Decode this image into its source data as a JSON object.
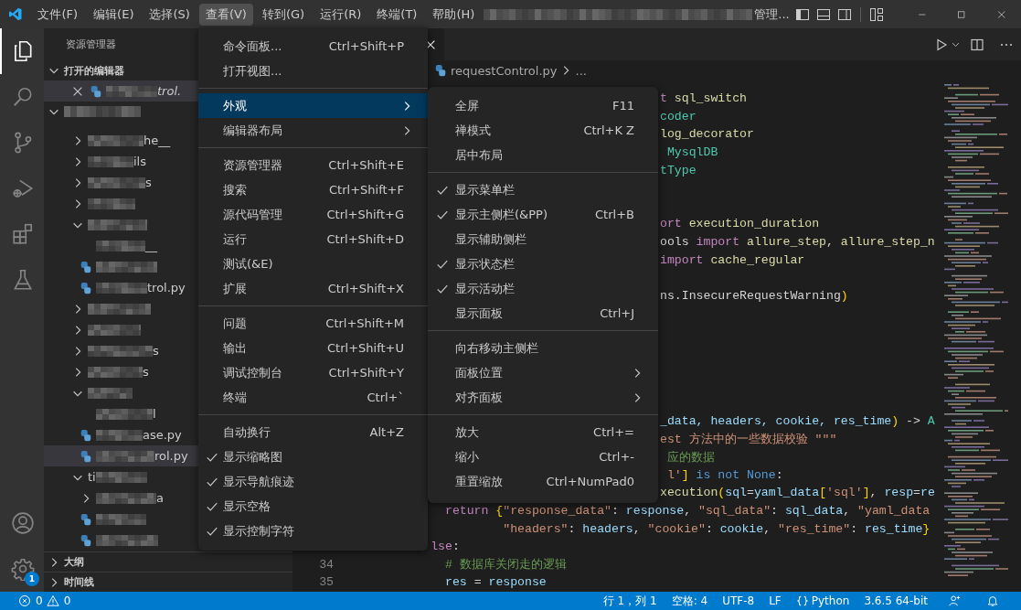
{
  "title_bar": {
    "menus": [
      {
        "label": "文件(F)",
        "selected": false
      },
      {
        "label": "编辑(E)",
        "selected": false
      },
      {
        "label": "选择(S)",
        "selected": false
      },
      {
        "label": "查看(V)",
        "selected": true
      },
      {
        "label": "转到(G)",
        "selected": false
      },
      {
        "label": "运行(R)",
        "selected": false
      },
      {
        "label": "终端(T)",
        "selected": false
      },
      {
        "label": "帮助(H)",
        "selected": false
      }
    ],
    "title_redacted": true,
    "account_text": "管理..."
  },
  "activity_bar": {
    "items": [
      {
        "kind": "files",
        "selected": true
      },
      {
        "kind": "search",
        "selected": false
      },
      {
        "kind": "source_control",
        "selected": false
      },
      {
        "kind": "run_debug",
        "selected": false
      },
      {
        "kind": "extensions",
        "selected": false
      },
      {
        "kind": "testing",
        "selected": false
      }
    ],
    "settings_badge": "1"
  },
  "sidebar": {
    "title": "资源管理器",
    "open_editors": {
      "label": "打开的编辑器",
      "expanded": true,
      "items": [
        {
          "name": "trol.",
          "preview": true,
          "selected": true
        }
      ]
    },
    "folder": {
      "expanded": true,
      "tree": [
        {
          "kind": "folder",
          "label": "he__",
          "blur_before": true,
          "expanded": false,
          "selected": false
        },
        {
          "kind": "folder",
          "label": "ils",
          "blur_before": true,
          "expanded": false,
          "selected": false
        },
        {
          "kind": "folder",
          "label": "s",
          "blur_before": true,
          "expanded": false,
          "selected": false
        },
        {
          "kind": "folder",
          "blur_before": true,
          "expanded": false,
          "selected": false
        },
        {
          "kind": "folder",
          "blur_before": true,
          "expanded": true,
          "selected": false,
          "children": [
            {
              "kind": "file",
              "label": "__",
              "blur_before": true,
              "selected": false
            },
            {
              "kind": "python",
              "blur_before": true,
              "selected": false
            },
            {
              "kind": "python",
              "label": "trol.py",
              "blur_before": true,
              "selected": false
            }
          ]
        },
        {
          "kind": "folder",
          "blur_before": true,
          "expanded": false,
          "selected": false
        },
        {
          "kind": "folder",
          "blur_before": true,
          "expanded": false,
          "selected": false
        },
        {
          "kind": "folder",
          "label": "s",
          "blur_before": true,
          "expanded": false,
          "selected": false
        },
        {
          "kind": "folder",
          "label": "s",
          "blur_before": true,
          "expanded": false,
          "selected": false
        },
        {
          "kind": "folder",
          "blur_before": true,
          "expanded": true,
          "selected": false,
          "children": [
            {
              "kind": "file",
              "label": "l",
              "blur_before": true,
              "selected": false
            },
            {
              "kind": "python",
              "label": "ase.py",
              "blur_before": true,
              "selected": false
            },
            {
              "kind": "python",
              "label": "rol.py",
              "blur_before": true,
              "selected": true
            }
          ]
        },
        {
          "kind": "folder",
          "label": "ti",
          "blur_after": true,
          "expanded": true,
          "selected": false,
          "children": [
            {
              "kind": "folder",
              "label": "a",
              "blur_before": true,
              "expanded": false,
              "selected": false
            },
            {
              "kind": "python",
              "blur_before": true,
              "selected": false
            },
            {
              "kind": "python",
              "blur_before": true,
              "selected": false
            }
          ]
        }
      ]
    },
    "sections": [
      {
        "label": "大纲",
        "expanded": false
      },
      {
        "label": "时间线",
        "expanded": false
      }
    ]
  },
  "editor": {
    "breadcrumb": {
      "file": "requestControl.py",
      "more": "..."
    },
    "lines": [
      {
        "kind": "clipped",
        "tokens": [
          {
            "kind": "control",
            "text": "t"
          },
          {
            "kind": "function",
            "text": " sql_switch"
          }
        ]
      },
      {
        "kind": "clipped",
        "tokens": [
          {
            "kind": "class",
            "text": "coder"
          }
        ]
      },
      {
        "kind": "clipped",
        "tokens": [
          {
            "kind": "function",
            "text": "log_decorator"
          }
        ]
      },
      {
        "kind": "clipped",
        "tokens": [
          {
            "kind": "class",
            "text": " MysqlDB"
          }
        ]
      },
      {
        "kind": "clipped",
        "tokens": [
          {
            "kind": "class",
            "text": "tType"
          }
        ]
      },
      {
        "kind": "blank"
      },
      {
        "kind": "blank"
      },
      {
        "kind": "clipped",
        "tokens": [
          {
            "kind": "control",
            "text": "ort"
          },
          {
            "kind": "function",
            "text": " execution_duration"
          }
        ]
      },
      {
        "kind": "clipped",
        "tokens": [
          {
            "kind": "plain",
            "text": "ools "
          },
          {
            "kind": "control",
            "text": "import"
          },
          {
            "kind": "function",
            "text": " allure_step"
          },
          {
            "kind": "plain",
            "text": ", "
          },
          {
            "kind": "function",
            "text": "allure_step_n"
          }
        ]
      },
      {
        "kind": "clipped",
        "tokens": [
          {
            "kind": "control",
            "text": "import"
          },
          {
            "kind": "function",
            "text": " cache_regular"
          }
        ]
      },
      {
        "kind": "blank"
      },
      {
        "kind": "clipped",
        "tokens": [
          {
            "kind": "plain",
            "text": "ns.InsecureRequestWarning"
          },
          {
            "kind": "bracket",
            "text": ")"
          }
        ]
      },
      {
        "kind": "blank"
      },
      {
        "kind": "blank"
      },
      {
        "kind": "blank"
      },
      {
        "kind": "blank"
      },
      {
        "kind": "blank"
      },
      {
        "kind": "blank"
      },
      {
        "kind": "clipped",
        "tokens": [
          {
            "kind": "variable",
            "text": "_data, headers, cookie, res_time"
          },
          {
            "kind": "bracket",
            "text": ")"
          },
          {
            "kind": "plain",
            "text": " -> "
          },
          {
            "kind": "class",
            "text": "A"
          }
        ]
      },
      {
        "kind": "clipped",
        "tokens": [
          {
            "kind": "string",
            "text": "est 方法中的一些数据校验 \"\"\""
          }
        ]
      },
      {
        "kind": "clipped",
        "tokens": [
          {
            "kind": "comment",
            "text": " 应的数据"
          }
        ]
      },
      {
        "kind": "clipped",
        "tokens": [
          {
            "kind": "string",
            "text": " l'"
          },
          {
            "kind": "bracket",
            "text": "]"
          },
          {
            "kind": "constant",
            "text": " is not None"
          },
          {
            "kind": "plain",
            "text": ":"
          }
        ]
      },
      {
        "kind": "clipped",
        "tokens": [
          {
            "kind": "function",
            "text": "xecution"
          },
          {
            "kind": "bracket",
            "text": "("
          },
          {
            "kind": "variable",
            "text": "sql"
          },
          {
            "kind": "plain",
            "text": "="
          },
          {
            "kind": "variable",
            "text": "yaml_data"
          },
          {
            "kind": "bracket",
            "text": "["
          },
          {
            "kind": "string",
            "text": "'sql'"
          },
          {
            "kind": "bracket",
            "text": "]"
          },
          {
            "kind": "plain",
            "text": ", "
          },
          {
            "kind": "variable",
            "text": "resp"
          },
          {
            "kind": "plain",
            "text": "="
          },
          {
            "kind": "variable",
            "text": "re"
          }
        ]
      },
      {
        "kind": "full",
        "tokens": [
          {
            "kind": "control",
            "text": "            return"
          },
          {
            "kind": "bracket",
            "text": " {"
          },
          {
            "kind": "string",
            "text": "\"response_data\""
          },
          {
            "kind": "plain",
            "text": ": "
          },
          {
            "kind": "variable",
            "text": "response"
          },
          {
            "kind": "plain",
            "text": ", "
          },
          {
            "kind": "string",
            "text": "\"sql_data\""
          },
          {
            "kind": "plain",
            "text": ": "
          },
          {
            "kind": "variable",
            "text": "sql_data"
          },
          {
            "kind": "plain",
            "text": ", "
          },
          {
            "kind": "string",
            "text": "\"yaml_data"
          }
        ]
      },
      {
        "kind": "full",
        "tokens": [
          {
            "kind": "string",
            "text": "                    \"headers\""
          },
          {
            "kind": "plain",
            "text": ": "
          },
          {
            "kind": "variable",
            "text": "headers"
          },
          {
            "kind": "plain",
            "text": ", "
          },
          {
            "kind": "string",
            "text": "\"cookie\""
          },
          {
            "kind": "plain",
            "text": ": "
          },
          {
            "kind": "variable",
            "text": "cookie"
          },
          {
            "kind": "plain",
            "text": ", "
          },
          {
            "kind": "string",
            "text": "\"res_time\""
          },
          {
            "kind": "plain",
            "text": ": "
          },
          {
            "kind": "variable",
            "text": "res_time"
          },
          {
            "kind": "bracket",
            "text": "}"
          }
        ]
      },
      {
        "kind": "full",
        "tokens": [
          {
            "kind": "control",
            "text": "          lse"
          },
          {
            "kind": "plain",
            "text": ":"
          }
        ]
      },
      {
        "kind": "full",
        "number": "34",
        "tokens": [
          {
            "kind": "comment",
            "text": "            # 数据库关闭走的逻辑"
          }
        ]
      },
      {
        "kind": "full",
        "number": "35",
        "tokens": [
          {
            "kind": "variable",
            "text": "            res"
          },
          {
            "kind": "plain",
            "text": " = "
          },
          {
            "kind": "variable",
            "text": "response"
          }
        ]
      }
    ]
  },
  "view_menu": {
    "items": [
      {
        "kind": "item",
        "label": "命令面板...",
        "shortcut": "Ctrl+Shift+P",
        "checked": false,
        "selected": false,
        "submenu": false
      },
      {
        "kind": "item",
        "label": "打开视图...",
        "checked": false,
        "selected": false,
        "submenu": false
      },
      {
        "kind": "separator"
      },
      {
        "kind": "item",
        "label": "外观",
        "checked": false,
        "selected": true,
        "submenu": true
      },
      {
        "kind": "item",
        "label": "编辑器布局",
        "checked": false,
        "selected": false,
        "submenu": true
      },
      {
        "kind": "separator"
      },
      {
        "kind": "item",
        "label": "资源管理器",
        "shortcut": "Ctrl+Shift+E",
        "checked": false,
        "selected": false,
        "submenu": false
      },
      {
        "kind": "item",
        "label": "搜索",
        "shortcut": "Ctrl+Shift+F",
        "checked": false,
        "selected": false,
        "submenu": false
      },
      {
        "kind": "item",
        "label": "源代码管理",
        "shortcut": "Ctrl+Shift+G",
        "checked": false,
        "selected": false,
        "submenu": false
      },
      {
        "kind": "item",
        "label": "运行",
        "shortcut": "Ctrl+Shift+D",
        "checked": false,
        "selected": false,
        "submenu": false
      },
      {
        "kind": "item",
        "label": "测试(&E)",
        "checked": false,
        "selected": false,
        "submenu": false
      },
      {
        "kind": "item",
        "label": "扩展",
        "shortcut": "Ctrl+Shift+X",
        "checked": false,
        "selected": false,
        "submenu": false
      },
      {
        "kind": "separator"
      },
      {
        "kind": "item",
        "label": "问题",
        "shortcut": "Ctrl+Shift+M",
        "checked": false,
        "selected": false,
        "submenu": false
      },
      {
        "kind": "item",
        "label": "输出",
        "shortcut": "Ctrl+Shift+U",
        "checked": false,
        "selected": false,
        "submenu": false
      },
      {
        "kind": "item",
        "label": "调试控制台",
        "shortcut": "Ctrl+Shift+Y",
        "checked": false,
        "selected": false,
        "submenu": false
      },
      {
        "kind": "item",
        "label": "终端",
        "shortcut": "Ctrl+`",
        "checked": false,
        "selected": false,
        "submenu": false
      },
      {
        "kind": "separator"
      },
      {
        "kind": "item",
        "label": "自动换行",
        "shortcut": "Alt+Z",
        "checked": false,
        "selected": false,
        "submenu": false
      },
      {
        "kind": "item",
        "label": "显示缩略图",
        "checked": true,
        "selected": false,
        "submenu": false
      },
      {
        "kind": "item",
        "label": "显示导航痕迹",
        "checked": true,
        "selected": false,
        "submenu": false
      },
      {
        "kind": "item",
        "label": "显示空格",
        "checked": true,
        "selected": false,
        "submenu": false
      },
      {
        "kind": "item",
        "label": "显示控制字符",
        "checked": true,
        "selected": false,
        "submenu": false
      }
    ]
  },
  "appearance_submenu": {
    "items": [
      {
        "kind": "item",
        "label": "全屏",
        "shortcut": "F11",
        "checked": false,
        "selected": false,
        "submenu": false
      },
      {
        "kind": "item",
        "label": "禅模式",
        "shortcut": "Ctrl+K Z",
        "checked": false,
        "selected": false,
        "submenu": false
      },
      {
        "kind": "item",
        "label": "居中布局",
        "checked": false,
        "selected": false,
        "submenu": false
      },
      {
        "kind": "separator"
      },
      {
        "kind": "item",
        "label": "显示菜单栏",
        "checked": true,
        "selected": false,
        "submenu": false
      },
      {
        "kind": "item",
        "label": "显示主侧栏(&PP)",
        "shortcut": "Ctrl+B",
        "checked": true,
        "selected": false,
        "submenu": false
      },
      {
        "kind": "item",
        "label": "显示辅助侧栏",
        "checked": false,
        "selected": false,
        "submenu": false
      },
      {
        "kind": "item",
        "label": "显示状态栏",
        "checked": true,
        "selected": false,
        "submenu": false
      },
      {
        "kind": "item",
        "label": "显示活动栏",
        "checked": true,
        "selected": false,
        "submenu": false
      },
      {
        "kind": "item",
        "label": "显示面板",
        "shortcut": "Ctrl+J",
        "checked": false,
        "selected": false,
        "submenu": false
      },
      {
        "kind": "separator"
      },
      {
        "kind": "item",
        "label": "向右移动主侧栏",
        "checked": false,
        "selected": false,
        "submenu": false
      },
      {
        "kind": "item",
        "label": "面板位置",
        "checked": false,
        "selected": false,
        "submenu": true
      },
      {
        "kind": "item",
        "label": "对齐面板",
        "checked": false,
        "selected": false,
        "submenu": true
      },
      {
        "kind": "separator"
      },
      {
        "kind": "item",
        "label": "放大",
        "shortcut": "Ctrl+=",
        "checked": false,
        "selected": false,
        "submenu": false
      },
      {
        "kind": "item",
        "label": "缩小",
        "shortcut": "Ctrl+-",
        "checked": false,
        "selected": false,
        "submenu": false
      },
      {
        "kind": "item",
        "label": "重置缩放",
        "shortcut": "Ctrl+NumPad0",
        "checked": false,
        "selected": false,
        "submenu": false
      }
    ]
  },
  "status_bar": {
    "errors": "0",
    "warnings": "0",
    "items": [
      {
        "kind": "text",
        "text": "行 1，列 1"
      },
      {
        "kind": "text",
        "text": "空格: 4"
      },
      {
        "kind": "text",
        "text": "UTF-8"
      },
      {
        "kind": "text",
        "text": "LF"
      },
      {
        "kind": "language",
        "text": "Python"
      },
      {
        "kind": "text",
        "text": "3.6.5 64-bit"
      }
    ]
  }
}
